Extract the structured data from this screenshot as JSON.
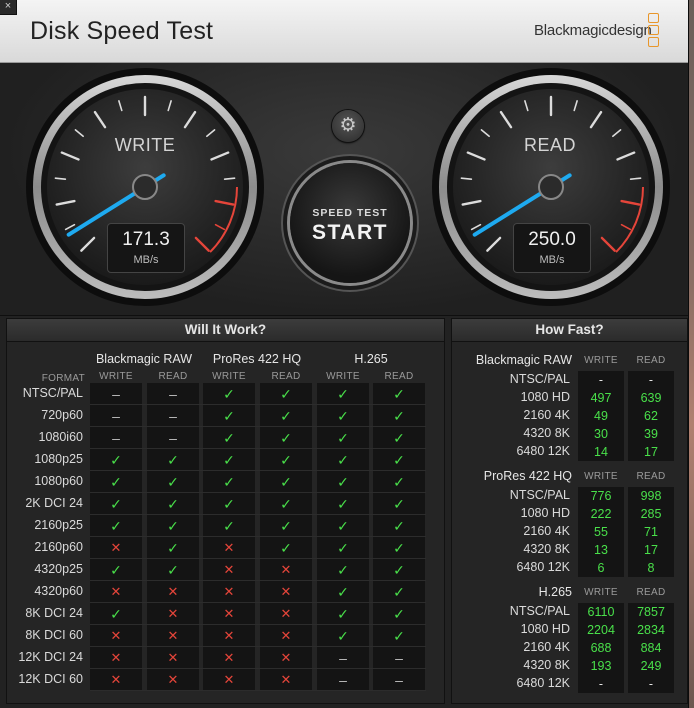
{
  "app": {
    "title": "Disk Speed Test",
    "brand": "Blackmagicdesign",
    "close_glyph": "×"
  },
  "colors": {
    "needle": "#1eaaf0",
    "redline": "#e5453a",
    "ok": "#49e04a",
    "bad": "#e5453a",
    "brand_logo": "#e8962a"
  },
  "gauges": {
    "write": {
      "label": "WRITE",
      "value": "171.3",
      "unit": "MB/s"
    },
    "read": {
      "label": "READ",
      "value": "250.0",
      "unit": "MB/s"
    }
  },
  "controls": {
    "start_small": "SPEED TEST",
    "start_big": "START",
    "settings_icon": "gear-icon"
  },
  "will_it_work": {
    "title": "Will It Work?",
    "format_label": "FORMAT",
    "write_label": "WRITE",
    "read_label": "READ",
    "codecs": [
      "Blackmagic RAW",
      "ProRes 422 HQ",
      "H.265"
    ],
    "rows": [
      {
        "format": "NTSC/PAL",
        "marks": [
          "na",
          "na",
          "ok",
          "ok",
          "ok",
          "ok"
        ]
      },
      {
        "format": "720p60",
        "marks": [
          "na",
          "na",
          "ok",
          "ok",
          "ok",
          "ok"
        ]
      },
      {
        "format": "1080i60",
        "marks": [
          "na",
          "na",
          "ok",
          "ok",
          "ok",
          "ok"
        ]
      },
      {
        "format": "1080p25",
        "marks": [
          "ok",
          "ok",
          "ok",
          "ok",
          "ok",
          "ok"
        ]
      },
      {
        "format": "1080p60",
        "marks": [
          "ok",
          "ok",
          "ok",
          "ok",
          "ok",
          "ok"
        ]
      },
      {
        "format": "2K DCI 24",
        "marks": [
          "ok",
          "ok",
          "ok",
          "ok",
          "ok",
          "ok"
        ]
      },
      {
        "format": "2160p25",
        "marks": [
          "ok",
          "ok",
          "ok",
          "ok",
          "ok",
          "ok"
        ]
      },
      {
        "format": "2160p60",
        "marks": [
          "x",
          "ok",
          "x",
          "ok",
          "ok",
          "ok"
        ]
      },
      {
        "format": "4320p25",
        "marks": [
          "ok",
          "ok",
          "x",
          "x",
          "ok",
          "ok"
        ]
      },
      {
        "format": "4320p60",
        "marks": [
          "x",
          "x",
          "x",
          "x",
          "ok",
          "ok"
        ]
      },
      {
        "format": "8K DCI 24",
        "marks": [
          "ok",
          "x",
          "x",
          "x",
          "ok",
          "ok"
        ]
      },
      {
        "format": "8K DCI 60",
        "marks": [
          "x",
          "x",
          "x",
          "x",
          "ok",
          "ok"
        ]
      },
      {
        "format": "12K DCI 24",
        "marks": [
          "x",
          "x",
          "x",
          "x",
          "na",
          "na"
        ]
      },
      {
        "format": "12K DCI 60",
        "marks": [
          "x",
          "x",
          "x",
          "x",
          "na",
          "na"
        ]
      }
    ]
  },
  "how_fast": {
    "title": "How Fast?",
    "write_label": "WRITE",
    "read_label": "READ",
    "groups": [
      {
        "codec": "Blackmagic RAW",
        "rows": [
          {
            "format": "NTSC/PAL",
            "write": "-",
            "read": "-"
          },
          {
            "format": "1080 HD",
            "write": "497",
            "read": "639"
          },
          {
            "format": "2160 4K",
            "write": "49",
            "read": "62"
          },
          {
            "format": "4320 8K",
            "write": "30",
            "read": "39"
          },
          {
            "format": "6480 12K",
            "write": "14",
            "read": "17"
          }
        ]
      },
      {
        "codec": "ProRes 422 HQ",
        "rows": [
          {
            "format": "NTSC/PAL",
            "write": "776",
            "read": "998"
          },
          {
            "format": "1080 HD",
            "write": "222",
            "read": "285"
          },
          {
            "format": "2160 4K",
            "write": "55",
            "read": "71"
          },
          {
            "format": "4320 8K",
            "write": "13",
            "read": "17"
          },
          {
            "format": "6480 12K",
            "write": "6",
            "read": "8"
          }
        ]
      },
      {
        "codec": "H.265",
        "rows": [
          {
            "format": "NTSC/PAL",
            "write": "6110",
            "read": "7857"
          },
          {
            "format": "1080 HD",
            "write": "2204",
            "read": "2834"
          },
          {
            "format": "2160 4K",
            "write": "688",
            "read": "884"
          },
          {
            "format": "4320 8K",
            "write": "193",
            "read": "249"
          },
          {
            "format": "6480 12K",
            "write": "-",
            "read": "-"
          }
        ]
      }
    ]
  }
}
